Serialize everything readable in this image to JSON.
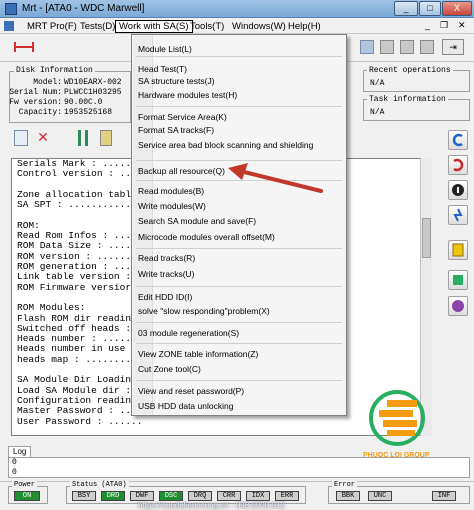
{
  "window": {
    "title": "Mrt - [ATA0 - WDC Marwell]",
    "min_label": "_",
    "max_label": "□",
    "close_label": "X"
  },
  "menu": {
    "mrt_pro": "MRT Pro(F)",
    "tests": "Tests(D)",
    "work_with_sa": "Work with SA(S)",
    "tools": "Tools(T)",
    "windows": "Windows(W)",
    "help": "Help(H)"
  },
  "disk_info": {
    "title": "Disk Information",
    "model_label": "Model:",
    "model_value": "WD10EARX-002",
    "serial_label": "Serial Num:",
    "serial_value": "PLWCC1H03295",
    "fw_label": "Fw version:",
    "fw_value": "90.00C.0",
    "capacity_label": "Capacity:",
    "capacity_value": "1953525168"
  },
  "recent_ops": {
    "title": "Recent operations",
    "value": "N/A"
  },
  "task_info": {
    "title": "Task information",
    "value": "N/A"
  },
  "log_lines": [
    "Serials Mark : .......",
    "Control version : ....",
    "",
    "Zone allocation tabl",
    "SA SPT : ............",
    "",
    "ROM:",
    "Read Rom Infos : .....",
    "ROM Data Size : .....",
    "ROM version : ........",
    "ROM generation : .....",
    "Link table version :",
    "ROM Firmware versior",
    "",
    "ROM Modules:",
    "Flash ROM dir readin",
    "Switched off heads :",
    "Heads number : .......",
    "Heads number in use",
    "heads map : ..........",
    "",
    "SA Module Dir Loadin",
    "Load SA Module dir :",
    "Configuration readin",
    "Master Password : ....",
    "User Password : ......"
  ],
  "dropdown": {
    "items": [
      "Module List(L)",
      "Head Test(T)",
      "SA structure tests(J)",
      "Hardware modules test(H)",
      "Format Service Area(K)",
      "Format SA tracks(F)",
      "Service area bad block scanning and shielding",
      "Backup all resource(Q)",
      "Read modules(B)",
      "Write modules(W)",
      "Search SA module and save(F)",
      "Microcode modules overall offset(M)",
      "Read tracks(R)",
      "Write tracks(U)",
      "Edit HDD ID(I)",
      "solve \"slow responding\"problem(X)",
      "03 module regeneration(S)",
      "View ZONE table information(Z)",
      "Cut Zone tool(C)",
      "View and reset password(P)",
      "USB HDD data unlocking"
    ]
  },
  "log_tab": {
    "label": "Log",
    "line1": "0",
    "line2": "0"
  },
  "power": {
    "title": "Power",
    "value": "ON"
  },
  "status": {
    "title": "Status (ATA0)",
    "flags": [
      "BSY",
      "DRD",
      "DWF",
      "DSC",
      "DRQ",
      "CRR",
      "IDX",
      "ERR"
    ]
  },
  "error": {
    "title": "Error",
    "flags": [
      "BBK",
      "UNC",
      "INF"
    ]
  },
  "watermark": {
    "brand": "PHUOC LOI GROUP",
    "footer": "https://cuudulieuocung.vn - 098.0000.912"
  },
  "colors": {
    "status_on": "#1f8f2f",
    "arrow": "#c0392b",
    "watermark_orange": "#f39c12",
    "watermark_green": "#27ae60"
  }
}
